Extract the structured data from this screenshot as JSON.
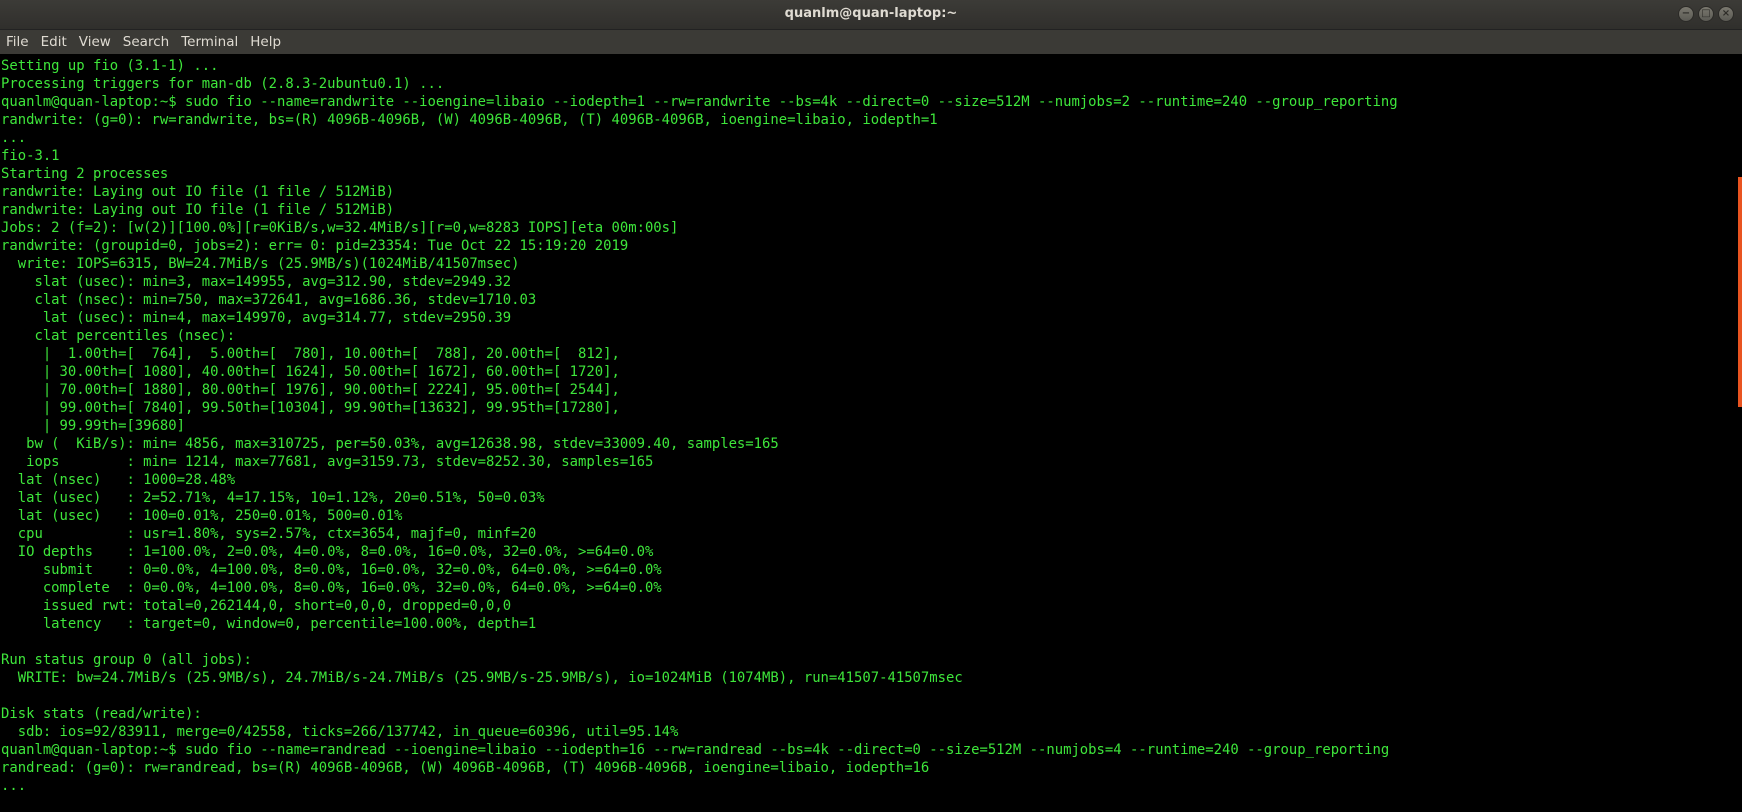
{
  "window": {
    "title": "quanlm@quan-laptop:~",
    "controls": {
      "minimize": "−",
      "maximize": "□",
      "close": "×"
    }
  },
  "menu": {
    "items": [
      "File",
      "Edit",
      "View",
      "Search",
      "Terminal",
      "Help"
    ]
  },
  "colors": {
    "terminal_text": "#3ee63b",
    "terminal_bg": "#000000",
    "scroll_thumb": "#e95420"
  },
  "terminal": {
    "lines": [
      "Setting up fio (3.1-1) ...",
      "Processing triggers for man-db (2.8.3-2ubuntu0.1) ...",
      "quanlm@quan-laptop:~$ sudo fio --name=randwrite --ioengine=libaio --iodepth=1 --rw=randwrite --bs=4k --direct=0 --size=512M --numjobs=2 --runtime=240 --group_reporting",
      "randwrite: (g=0): rw=randwrite, bs=(R) 4096B-4096B, (W) 4096B-4096B, (T) 4096B-4096B, ioengine=libaio, iodepth=1",
      "...",
      "fio-3.1",
      "Starting 2 processes",
      "randwrite: Laying out IO file (1 file / 512MiB)",
      "randwrite: Laying out IO file (1 file / 512MiB)",
      "Jobs: 2 (f=2): [w(2)][100.0%][r=0KiB/s,w=32.4MiB/s][r=0,w=8283 IOPS][eta 00m:00s]",
      "randwrite: (groupid=0, jobs=2): err= 0: pid=23354: Tue Oct 22 15:19:20 2019",
      "  write: IOPS=6315, BW=24.7MiB/s (25.9MB/s)(1024MiB/41507msec)",
      "    slat (usec): min=3, max=149955, avg=312.90, stdev=2949.32",
      "    clat (nsec): min=750, max=372641, avg=1686.36, stdev=1710.03",
      "     lat (usec): min=4, max=149970, avg=314.77, stdev=2950.39",
      "    clat percentiles (nsec):",
      "     |  1.00th=[  764],  5.00th=[  780], 10.00th=[  788], 20.00th=[  812],",
      "     | 30.00th=[ 1080], 40.00th=[ 1624], 50.00th=[ 1672], 60.00th=[ 1720],",
      "     | 70.00th=[ 1880], 80.00th=[ 1976], 90.00th=[ 2224], 95.00th=[ 2544],",
      "     | 99.00th=[ 7840], 99.50th=[10304], 99.90th=[13632], 99.95th=[17280],",
      "     | 99.99th=[39680]",
      "   bw (  KiB/s): min= 4856, max=310725, per=50.03%, avg=12638.98, stdev=33009.40, samples=165",
      "   iops        : min= 1214, max=77681, avg=3159.73, stdev=8252.30, samples=165",
      "  lat (nsec)   : 1000=28.48%",
      "  lat (usec)   : 2=52.71%, 4=17.15%, 10=1.12%, 20=0.51%, 50=0.03%",
      "  lat (usec)   : 100=0.01%, 250=0.01%, 500=0.01%",
      "  cpu          : usr=1.80%, sys=2.57%, ctx=3654, majf=0, minf=20",
      "  IO depths    : 1=100.0%, 2=0.0%, 4=0.0%, 8=0.0%, 16=0.0%, 32=0.0%, >=64=0.0%",
      "     submit    : 0=0.0%, 4=100.0%, 8=0.0%, 16=0.0%, 32=0.0%, 64=0.0%, >=64=0.0%",
      "     complete  : 0=0.0%, 4=100.0%, 8=0.0%, 16=0.0%, 32=0.0%, 64=0.0%, >=64=0.0%",
      "     issued rwt: total=0,262144,0, short=0,0,0, dropped=0,0,0",
      "     latency   : target=0, window=0, percentile=100.00%, depth=1",
      "",
      "Run status group 0 (all jobs):",
      "  WRITE: bw=24.7MiB/s (25.9MB/s), 24.7MiB/s-24.7MiB/s (25.9MB/s-25.9MB/s), io=1024MiB (1074MB), run=41507-41507msec",
      "",
      "Disk stats (read/write):",
      "  sdb: ios=92/83911, merge=0/42558, ticks=266/137742, in_queue=60396, util=95.14%",
      "quanlm@quan-laptop:~$ sudo fio --name=randread --ioengine=libaio --iodepth=16 --rw=randread --bs=4k --direct=0 --size=512M --numjobs=4 --runtime=240 --group_reporting",
      "randread: (g=0): rw=randread, bs=(R) 4096B-4096B, (W) 4096B-4096B, (T) 4096B-4096B, ioengine=libaio, iodepth=16",
      "...",
      "fio-3.1"
    ]
  }
}
